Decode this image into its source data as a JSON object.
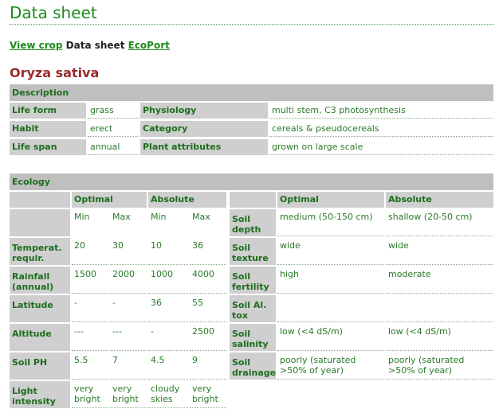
{
  "page": {
    "title": "Data sheet"
  },
  "nav": {
    "view_crop": "View crop",
    "data_sheet": "Data sheet",
    "ecoport": "EcoPort"
  },
  "species": "Oryza sativa",
  "description": {
    "header": "Description",
    "life_form_label": "Life form",
    "life_form": "grass",
    "habit_label": "Habit",
    "habit": "erect",
    "life_span_label": "Life span",
    "life_span": "annual",
    "physiology_label": "Physiology",
    "physiology": "multi stem, C3 photosynthesis",
    "category_label": "Category",
    "category": "cereals & pseudocereals",
    "plant_attributes_label": "Plant attributes",
    "plant_attributes": "grown on large scale"
  },
  "ecology": {
    "header": "Ecology",
    "optimal": "Optimal",
    "absolute": "Absolute",
    "min": "Min",
    "max": "Max",
    "rows": [
      {
        "label": "Temperat. requir.",
        "opt_min": "20",
        "opt_max": "30",
        "abs_min": "10",
        "abs_max": "36"
      },
      {
        "label": "Rainfall (annual)",
        "opt_min": "1500",
        "opt_max": "2000",
        "abs_min": "1000",
        "abs_max": "4000"
      },
      {
        "label": "Latitude",
        "opt_min": "-",
        "opt_max": "-",
        "abs_min": "36",
        "abs_max": "55"
      },
      {
        "label": "Altitude",
        "opt_min": "---",
        "opt_max": "---",
        "abs_min": "-",
        "abs_max": "2500"
      },
      {
        "label": "Soil PH",
        "opt_min": "5.5",
        "opt_max": "7",
        "abs_min": "4.5",
        "abs_max": "9"
      },
      {
        "label": "Light intensity",
        "opt_min": "very bright",
        "opt_max": "very bright",
        "abs_min": "cloudy skies",
        "abs_max": "very bright"
      }
    ],
    "soil": [
      {
        "label": "Soil depth",
        "optimal": "medium (50-150 cm)",
        "absolute": "shallow (20-50 cm)"
      },
      {
        "label": "Soil texture",
        "optimal": "wide",
        "absolute": "wide"
      },
      {
        "label": "Soil fertility",
        "optimal": "high",
        "absolute": "moderate"
      },
      {
        "label": "Soil Al. tox",
        "optimal": "",
        "absolute": ""
      },
      {
        "label": "Soil salinity",
        "optimal": "low (<4 dS/m)",
        "absolute": "low (<4 dS/m)"
      },
      {
        "label": "Soil drainage",
        "optimal": "poorly (saturated >50% of year)",
        "absolute": "poorly (saturated >50% of year)"
      }
    ]
  }
}
